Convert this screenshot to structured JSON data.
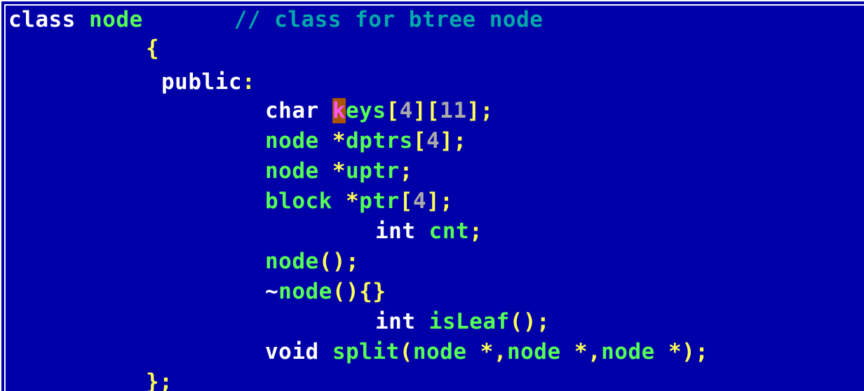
{
  "colors": {
    "background": "#0000a8",
    "keyword": "#ffffff",
    "identifier": "#55ff55",
    "symbol": "#ffff55",
    "number": "#aaaaaa",
    "comment": "#00aaaa",
    "cursor_bg": "#aa5500"
  },
  "code": {
    "line1": {
      "kw": "class",
      "id": "node",
      "comment": "// class for btree node"
    },
    "line2": {
      "sym": "{"
    },
    "line3": {
      "kw": "public",
      "sym": ":"
    },
    "line4": {
      "kw": "char",
      "cursor": "k",
      "id": "eys",
      "b1": "[",
      "n1": "4",
      "b2": "][",
      "n2": "11",
      "b3": "];"
    },
    "line5": {
      "id1": "node",
      "sym1": "*",
      "id2": "dptrs",
      "b1": "[",
      "n1": "4",
      "b2": "];"
    },
    "line6": {
      "id1": "node",
      "sym1": "*",
      "id2": "uptr",
      "sym2": ";"
    },
    "line7": {
      "id1": "block",
      "sym1": "*",
      "id2": "ptr",
      "b1": "[",
      "n1": "4",
      "b2": "];"
    },
    "line8": {
      "kw": "int",
      "id": "cnt",
      "sym": ";"
    },
    "line9": {
      "id": "node",
      "sym": "();"
    },
    "line10": {
      "tilde": "~",
      "id": "node",
      "sym": "(){}"
    },
    "line11": {
      "kw": "int",
      "id": "isLeaf",
      "sym": "();"
    },
    "line12": {
      "kw": "void",
      "id1": "split",
      "p1": "(",
      "id2": "node",
      "s1": "*,",
      "id3": "node",
      "s2": "*,",
      "id4": "node",
      "s3": "*);"
    },
    "line13": {
      "sym": "};"
    }
  }
}
